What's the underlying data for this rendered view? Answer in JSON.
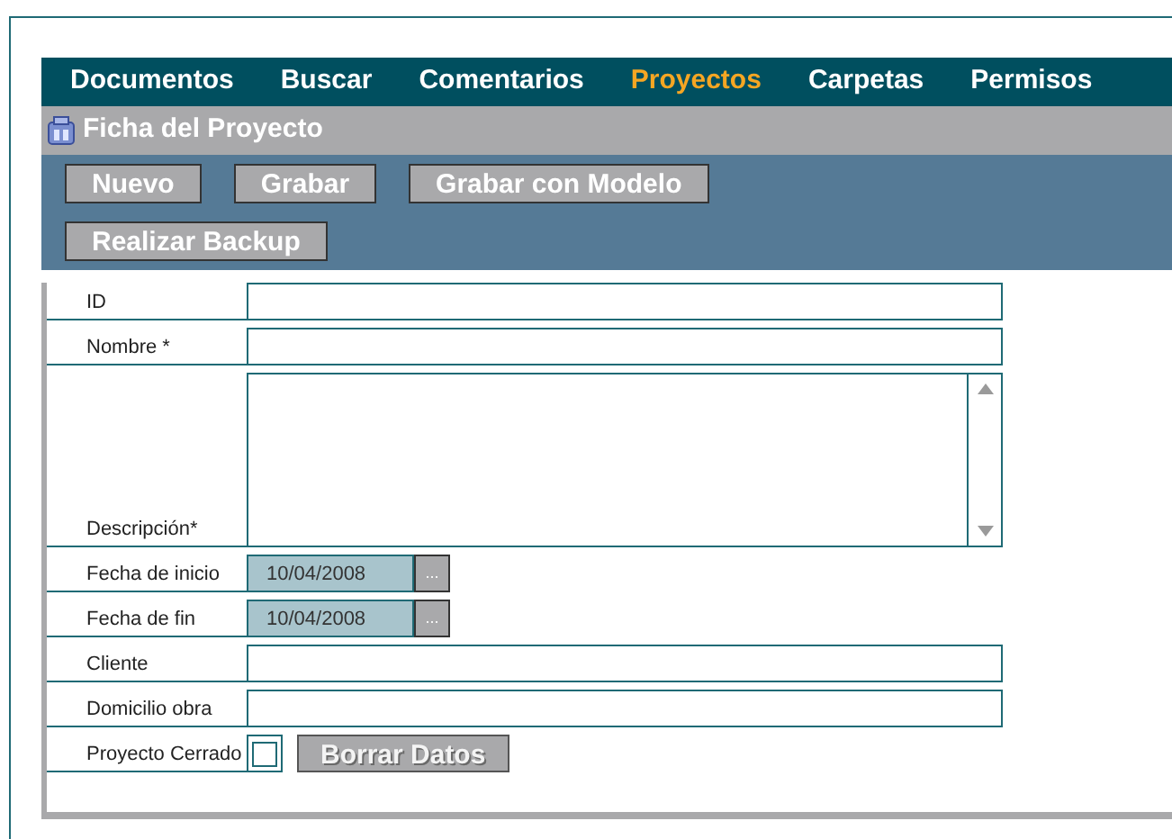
{
  "nav": [
    {
      "label": "Documentos",
      "selected": false
    },
    {
      "label": "Buscar",
      "selected": false
    },
    {
      "label": "Comentarios",
      "selected": false
    },
    {
      "label": "Proyectos",
      "selected": true
    },
    {
      "label": "Carpetas",
      "selected": false
    },
    {
      "label": "Permisos",
      "selected": false
    }
  ],
  "title": "Ficha del Proyecto",
  "toolbar": [
    [
      "Nuevo",
      "Grabar",
      "Grabar con Modelo"
    ],
    [
      "Realizar Backup"
    ]
  ],
  "fields": [
    {
      "kind": "text",
      "label": "ID"
    },
    {
      "kind": "text",
      "label": "Nombre *"
    },
    {
      "kind": "textarea",
      "label": "Descripción*"
    },
    {
      "kind": "date",
      "label": "Fecha de inicio",
      "value": "10/04/2008",
      "picker": "..."
    },
    {
      "kind": "date",
      "label": "Fecha de fin",
      "value": "10/04/2008",
      "picker": "..."
    },
    {
      "kind": "text",
      "label": "Cliente"
    },
    {
      "kind": "text",
      "label": "Domicilio obra"
    },
    {
      "kind": "checkbox",
      "label": "Proyecto Cerrado",
      "checked": false,
      "button": {
        "label": "Borrar Datos",
        "disabled": true
      }
    }
  ]
}
